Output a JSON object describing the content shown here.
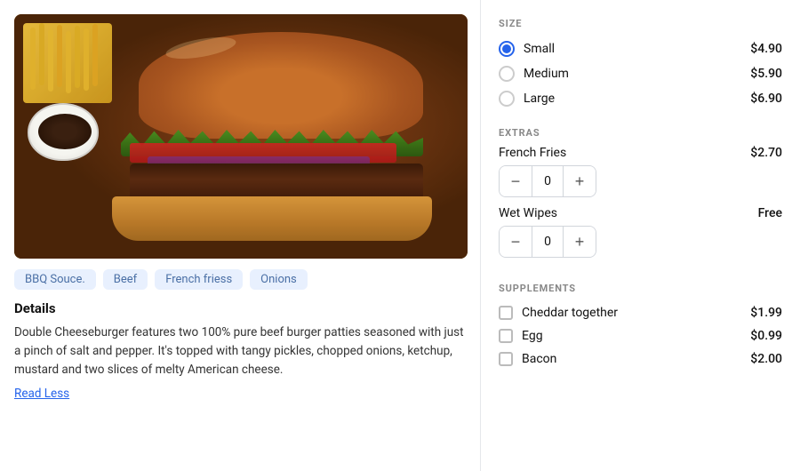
{
  "left": {
    "tags": [
      "BBQ Souce.",
      "Beef",
      "French friess",
      "Onions"
    ],
    "details_title": "Details",
    "details_text": "Double Cheeseburger features two 100% pure beef burger patties seasoned with just a pinch of salt and pepper. It's topped with tangy pickles, chopped onions, ketchup, mustard and two slices of melty American cheese.",
    "read_less": "Read Less"
  },
  "right": {
    "size_label": "SIZE",
    "sizes": [
      {
        "name": "Small",
        "price": "$4.90",
        "selected": true
      },
      {
        "name": "Medium",
        "price": "$5.90",
        "selected": false
      },
      {
        "name": "Large",
        "price": "$6.90",
        "selected": false
      }
    ],
    "extras_label": "EXTRAS",
    "extras": [
      {
        "name": "French Fries",
        "price": "$2.70",
        "qty": "0"
      },
      {
        "name": "Wet Wipes",
        "price": "Free",
        "qty": "0"
      }
    ],
    "supplements_label": "SUPPLEMENTS",
    "supplements": [
      {
        "name": "Cheddar together",
        "price": "$1.99"
      },
      {
        "name": "Egg",
        "price": "$0.99"
      },
      {
        "name": "Bacon",
        "price": "$2.00"
      }
    ],
    "stepper_minus": "−",
    "stepper_plus": "+"
  }
}
